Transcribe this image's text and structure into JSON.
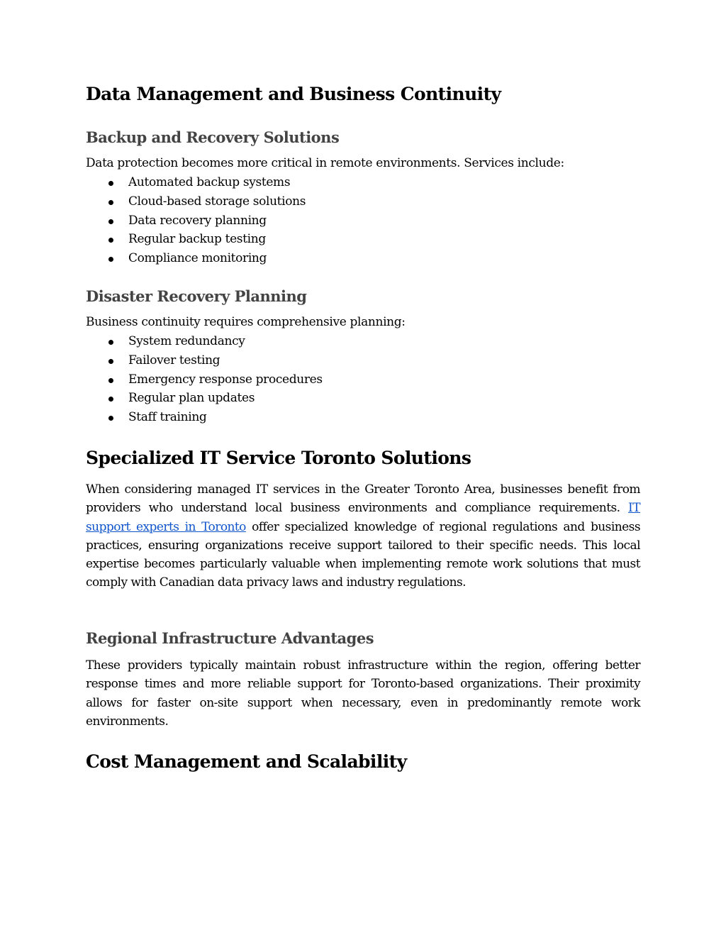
{
  "sections": {
    "data_management": {
      "title": "Data Management and Business Continuity",
      "backup": {
        "heading": "Backup and Recovery Solutions",
        "intro": "Data protection becomes more critical in remote environments. Services include:",
        "items": [
          "Automated backup systems",
          "Cloud-based storage solutions",
          "Data recovery planning",
          "Regular backup testing",
          "Compliance monitoring"
        ]
      },
      "disaster": {
        "heading": "Disaster Recovery Planning",
        "intro": "Business continuity requires comprehensive planning:",
        "items": [
          "System redundancy",
          "Failover testing",
          "Emergency response procedures",
          "Regular plan updates",
          "Staff training"
        ]
      }
    },
    "specialized": {
      "title": "Specialized IT Service Toronto Solutions",
      "para_before_link": "When considering managed IT services in the Greater Toronto Area, businesses benefit from providers who understand local business environments and compliance requirements. ",
      "link_text": "IT support experts in Toronto",
      "para_after_link": " offer specialized knowledge of regional regulations and business practices, ensuring organizations receive support tailored to their specific needs. This local expertise becomes particularly valuable when implementing remote work solutions that must comply with Canadian data privacy laws and industry regulations.",
      "regional": {
        "heading": "Regional Infrastructure Advantages",
        "text": "These providers typically maintain robust infrastructure within the region, offering better response times and more reliable support for Toronto-based organizations. Their proximity allows for faster on-site support when necessary, even in predominantly remote work environments."
      }
    },
    "cost": {
      "title": "Cost Management and Scalability"
    }
  },
  "colors": {
    "link": "#1155cc",
    "subheading": "#434343"
  }
}
